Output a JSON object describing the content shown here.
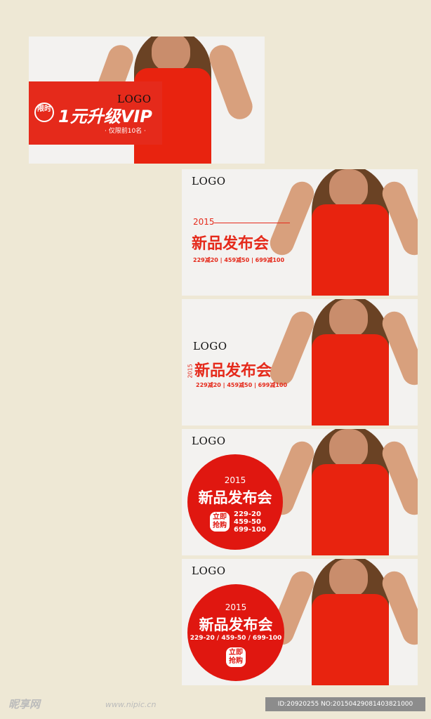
{
  "banners": [
    {
      "logo": "LOGO",
      "badge": "限时",
      "headline": "1元升级VIP",
      "sub": "· 仅限前10名 ·"
    },
    {
      "logo": "LOGO",
      "year": "2015",
      "title": "新品发布会",
      "promo": "229减20 | 459减50 | 699减100"
    },
    {
      "logo": "LOGO",
      "year": "2015",
      "title": "新品发布会",
      "promo": "229减20 | 459减50 | 699减100"
    },
    {
      "logo": "LOGO",
      "year": "2015",
      "title": "新品发布会",
      "buy": "立即抢购",
      "promo_lines": [
        "229-20",
        "459-50",
        "699-100"
      ]
    },
    {
      "logo": "LOGO",
      "year": "2015",
      "title": "新品发布会",
      "promo": "229-20 / 459-50 / 699-100",
      "buy": "立即抢购"
    }
  ],
  "footer": {
    "brand": "昵享网",
    "url": "www.nipic.cn",
    "id": "ID:20920255 NO:20150429081403821000"
  },
  "colors": {
    "background": "#eee8d5",
    "accent": "#e52a1b",
    "dress": "#e8230f"
  }
}
